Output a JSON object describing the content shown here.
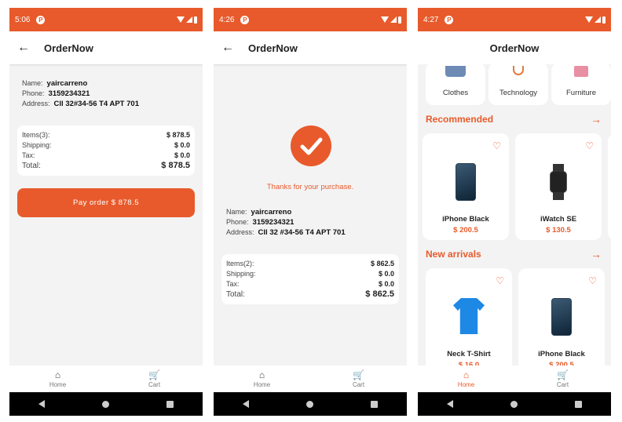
{
  "colors": {
    "accent": "#e85a2b",
    "background": "#f3f3f3",
    "card": "#ffffff"
  },
  "screens": [
    {
      "status": {
        "time": "5:06"
      },
      "appbar": {
        "title": "OrderNow"
      },
      "address": {
        "name_label": "Name:",
        "name": "yaircarreno",
        "phone_label": "Phone:",
        "phone": "3159234321",
        "address_label": "Address:",
        "address": "Cll 32#34-56 T4 APT 701"
      },
      "totals": {
        "items_label": "Items(3):",
        "items": "$ 878.5",
        "shipping_label": "Shipping:",
        "shipping": "$ 0.0",
        "tax_label": "Tax:",
        "tax": "$ 0.0",
        "total_label": "Total:",
        "total": "$ 878.5"
      },
      "pay_button": "Pay order $ 878.5"
    },
    {
      "status": {
        "time": "4:26"
      },
      "appbar": {
        "title": "OrderNow"
      },
      "thanks": "Thanks for your purchase.",
      "address": {
        "name_label": "Name:",
        "name": "yaircarreno",
        "phone_label": "Phone:",
        "phone": "3159234321",
        "address_label": "Address:",
        "address": "Cll 32 #34-56 T4 APT 701"
      },
      "totals": {
        "items_label": "Items(2):",
        "items": "$ 862.5",
        "shipping_label": "Shipping:",
        "shipping": "$ 0.0",
        "tax_label": "Tax:",
        "tax": "$ 0.0",
        "total_label": "Total:",
        "total": "$ 862.5"
      }
    },
    {
      "status": {
        "time": "4:27"
      },
      "appbar": {
        "title": "OrderNow"
      },
      "categories": [
        "Clothes",
        "Technology",
        "Furniture"
      ],
      "recommended": {
        "title": "Recommended",
        "products": [
          {
            "name": "iPhone Black",
            "price": "$ 200.5"
          },
          {
            "name": "iWatch SE",
            "price": "$ 130.5"
          }
        ]
      },
      "new_arrivals": {
        "title": "New arrivals",
        "products": [
          {
            "name": "Neck T-Shirt",
            "price": "$ 16.0"
          },
          {
            "name": "iPhone Black",
            "price": "$ 200.5"
          }
        ]
      }
    }
  ],
  "bottom_nav": {
    "home": "Home",
    "cart": "Cart"
  }
}
